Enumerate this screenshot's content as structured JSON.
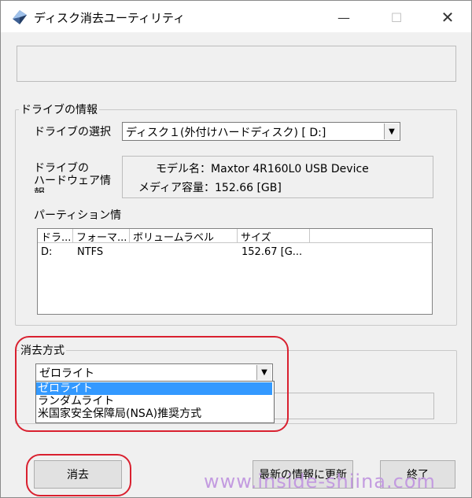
{
  "window": {
    "title": "ディスク消去ユーティリティ",
    "minimize_glyph": "—",
    "maximize_glyph": "☐",
    "close_glyph": "✕"
  },
  "drive_group": {
    "legend": "ドライブの情報",
    "select_label": "ドライブの選択",
    "selected_drive": "ディスク１(外付けハードディスク) [ D:]",
    "hw_label_line1": "ドライブの",
    "hw_label_line2": "ハードウェア情",
    "hw_label_line3": "報",
    "model_line": "モデル名：Maxtor 4R160L0 USB Device",
    "capacity_line": "メディア容量：152.66 [GB]",
    "partition_label": "パーティション情",
    "partition_columns": [
      "ドラ...",
      "フォーマ...",
      "ボリュームラベル",
      "サイズ"
    ],
    "partition_rows": [
      [
        "D:",
        "NTFS",
        "",
        "152.67 [G..."
      ]
    ]
  },
  "erase_group": {
    "legend": "消去方式",
    "selected_method": "ゼロライト",
    "options": [
      "ゼロライト",
      "ランダムライト",
      "米国家安全保障局(NSA)推奨方式"
    ],
    "highlighted_index": 0
  },
  "buttons": {
    "erase": "消去",
    "refresh": "最新の情報に更新",
    "exit": "終了"
  },
  "watermark": "www.inside-shiina.com",
  "colors": {
    "highlight_red": "#d9202f",
    "selection_blue": "#3399ff",
    "watermark": "#c39be0"
  },
  "icons": {
    "app": "disk-icon",
    "dropdown": "chevron-down-icon"
  }
}
